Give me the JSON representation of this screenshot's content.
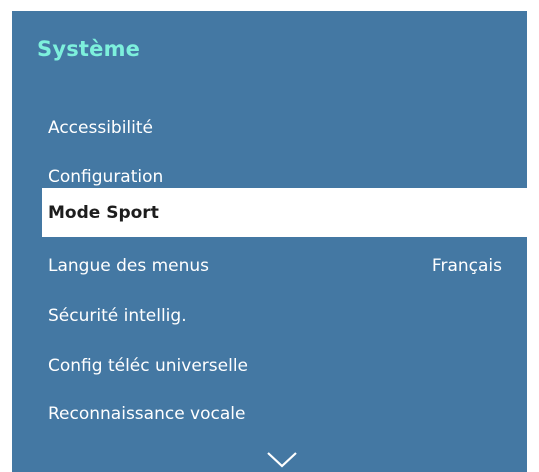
{
  "menu": {
    "title": "Système",
    "items": [
      {
        "label": "Accessibilité",
        "value": ""
      },
      {
        "label": "Configuration",
        "value": ""
      },
      {
        "label": "Mode Sport",
        "value": "",
        "selected": true
      },
      {
        "label": "Langue des menus",
        "value": "Français"
      },
      {
        "label": "Sécurité intellig.",
        "value": ""
      },
      {
        "label": "Config téléc universelle",
        "value": ""
      },
      {
        "label": "Reconnaissance vocale",
        "value": ""
      }
    ],
    "scroll_icon": "chevron-down-icon"
  },
  "colors": {
    "panel_background": "#4478a3",
    "title_accent": "#7df0dc",
    "selected_background": "#ffffff",
    "selected_text": "#1d1d1d",
    "item_text": "#ffffff"
  }
}
